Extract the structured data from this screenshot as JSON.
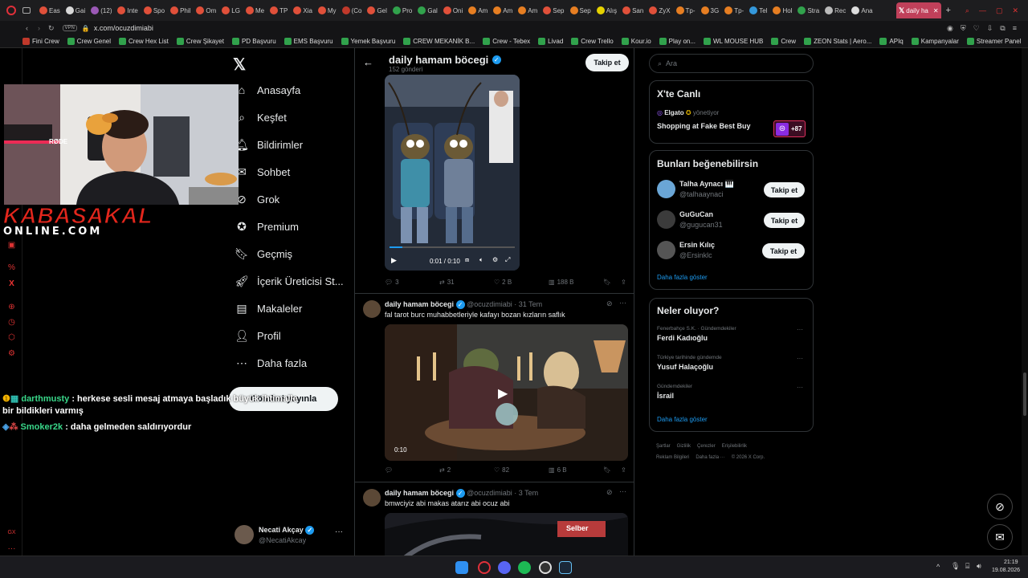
{
  "browser": {
    "tabs": [
      "Eas",
      "Gai",
      "(12)",
      "Inte",
      "Spo",
      "Phil",
      "Om",
      "LG",
      "Me",
      "TP",
      "Xia",
      "My",
      "(Co",
      "Gel",
      "Pro",
      "Gal",
      "Oni",
      "Am",
      "Am",
      "Am",
      "Sep",
      "Sep",
      "Alış",
      "San",
      "ZyX",
      "Tp-",
      "3G",
      "Tp-",
      "Tel",
      "Hol",
      "Stra",
      "Rec",
      "Ana"
    ],
    "active_tab": "daily ha",
    "vpn_label": "VPN",
    "url": "x.com/ocuzdimiabi",
    "bookmarks": [
      "Fini Crew",
      "Crew Genel",
      "Crew Hex List",
      "Crew Şikayet",
      "PD Başvuru",
      "EMS Başvuru",
      "Yemek Başvuru",
      "CREW MEKANİK B...",
      "Crew - Tebex",
      "Livad",
      "Crew Trello",
      "Kour.io",
      "Play on...",
      "WL MOUSE HUB",
      "Crew",
      "ZEON Stats | Aero...",
      "APIq",
      "Kampanyalar",
      "Streamer Panel"
    ]
  },
  "overlay": {
    "brand_top": "KABASAKAL",
    "brand_bottom": "ONLINE.COM",
    "cam_mic_label": "RØDE",
    "chat": [
      {
        "user": "darthmusty",
        "text": ": herkese sesli mesaj atmaya başladık büyük ihtimalle",
        "cont": "bir bildikleri varmış"
      },
      {
        "user": "Smoker2k",
        "text": ": daha gelmeden saldırıyordur"
      }
    ]
  },
  "nav": {
    "items": [
      {
        "label": "Anasayfa",
        "icon": "home-icon"
      },
      {
        "label": "Keşfet",
        "icon": "search-icon"
      },
      {
        "label": "Bildirimler",
        "icon": "bell-icon"
      },
      {
        "label": "Sohbet",
        "icon": "chat-icon"
      },
      {
        "label": "Grok",
        "icon": "grok-icon"
      },
      {
        "label": "Premium",
        "icon": "premium-icon"
      },
      {
        "label": "Geçmiş",
        "icon": "bookmark-icon"
      },
      {
        "label": "İçerik Üreticisi St...",
        "icon": "rocket-icon"
      },
      {
        "label": "Makaleler",
        "icon": "article-icon"
      },
      {
        "label": "Profil",
        "icon": "profile-icon"
      },
      {
        "label": "Daha fazla",
        "icon": "more-icon"
      }
    ],
    "post_button": "Gönderi yayınla",
    "account": {
      "name": "Necati Akçay",
      "handle": "@NecatiAkcay"
    }
  },
  "profile": {
    "name": "daily hamam böcegi",
    "post_count": "152 gönderi",
    "follow": "Takip et"
  },
  "posts": [
    {
      "video_time": "0:01 / 0:10",
      "video_progress": 0.1,
      "replies": "3",
      "reposts": "31",
      "likes": "2 B",
      "views": "188 B"
    },
    {
      "name": "daily hamam böcegi",
      "handle": "@ocuzdimiabi",
      "date": "· 31 Tem",
      "text": "fal tarot burc muhabbetleriyle kafayı bozan kızların saflık",
      "duration": "0:10",
      "replies": "",
      "reposts": "2",
      "likes": "82",
      "views": "6 B"
    },
    {
      "name": "daily hamam böcegi",
      "handle": "@ocuzdimiabi",
      "date": "· 3 Tem",
      "text": "bmwciyiz abi makas atarız abi ocuz abi",
      "overlay_sign": "Selber"
    }
  ],
  "sidebar": {
    "search_placeholder": "Ara",
    "live": {
      "title": "X'te Canlı",
      "host": "Elgato",
      "host_suffix": "yönetiyor",
      "show": "Shopping at Fake Best Buy",
      "viewers": "+87"
    },
    "who_to_follow": {
      "title": "Bunları beğenebilirsin",
      "users": [
        {
          "name": "Talha Aynacı 🎹",
          "handle": "@talhaaynaci",
          "follow": "Takip et"
        },
        {
          "name": "GuGuCan",
          "handle": "@gugucan31",
          "follow": "Takip et"
        },
        {
          "name": "Ersin Kılıç",
          "handle": "@Ersinklc",
          "follow": "Takip et"
        }
      ],
      "more": "Daha fazla göster"
    },
    "trends": {
      "title": "Neler oluyor?",
      "items": [
        {
          "context": "Fenerbahçe S.K. · Gündemdekiler",
          "topic": "Ferdi Kadıoğlu"
        },
        {
          "context": "Türkiye tarihinde gündemde",
          "topic": "Yusuf Halaçoğlu"
        },
        {
          "context": "Gündemdekiler",
          "topic": "İsrail"
        }
      ],
      "more": "Daha fazla göster"
    },
    "footer": [
      "Şartlar",
      "Gizlilik",
      "Çerezler",
      "Erişilebilirlik",
      "Reklam Bilgileri",
      "Daha fazla ···",
      "© 2026 X Corp."
    ]
  },
  "taskbar": {
    "time": "21:19",
    "date": "19.08.2026"
  }
}
